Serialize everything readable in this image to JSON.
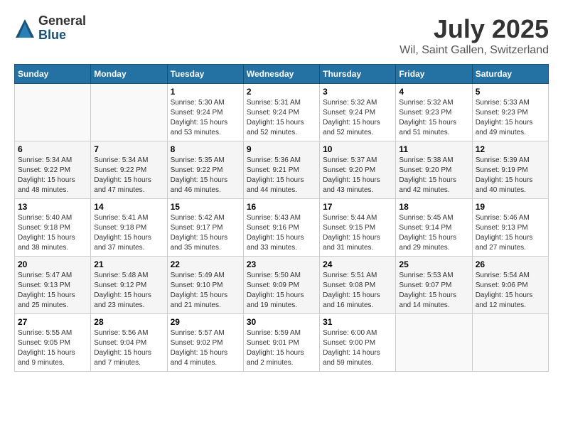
{
  "header": {
    "logo_general": "General",
    "logo_blue": "Blue",
    "month_title": "July 2025",
    "location": "Wil, Saint Gallen, Switzerland"
  },
  "weekdays": [
    "Sunday",
    "Monday",
    "Tuesday",
    "Wednesday",
    "Thursday",
    "Friday",
    "Saturday"
  ],
  "weeks": [
    [
      {
        "day": "",
        "info": ""
      },
      {
        "day": "",
        "info": ""
      },
      {
        "day": "1",
        "info": "Sunrise: 5:30 AM\nSunset: 9:24 PM\nDaylight: 15 hours\nand 53 minutes."
      },
      {
        "day": "2",
        "info": "Sunrise: 5:31 AM\nSunset: 9:24 PM\nDaylight: 15 hours\nand 52 minutes."
      },
      {
        "day": "3",
        "info": "Sunrise: 5:32 AM\nSunset: 9:24 PM\nDaylight: 15 hours\nand 52 minutes."
      },
      {
        "day": "4",
        "info": "Sunrise: 5:32 AM\nSunset: 9:23 PM\nDaylight: 15 hours\nand 51 minutes."
      },
      {
        "day": "5",
        "info": "Sunrise: 5:33 AM\nSunset: 9:23 PM\nDaylight: 15 hours\nand 49 minutes."
      }
    ],
    [
      {
        "day": "6",
        "info": "Sunrise: 5:34 AM\nSunset: 9:22 PM\nDaylight: 15 hours\nand 48 minutes."
      },
      {
        "day": "7",
        "info": "Sunrise: 5:34 AM\nSunset: 9:22 PM\nDaylight: 15 hours\nand 47 minutes."
      },
      {
        "day": "8",
        "info": "Sunrise: 5:35 AM\nSunset: 9:22 PM\nDaylight: 15 hours\nand 46 minutes."
      },
      {
        "day": "9",
        "info": "Sunrise: 5:36 AM\nSunset: 9:21 PM\nDaylight: 15 hours\nand 44 minutes."
      },
      {
        "day": "10",
        "info": "Sunrise: 5:37 AM\nSunset: 9:20 PM\nDaylight: 15 hours\nand 43 minutes."
      },
      {
        "day": "11",
        "info": "Sunrise: 5:38 AM\nSunset: 9:20 PM\nDaylight: 15 hours\nand 42 minutes."
      },
      {
        "day": "12",
        "info": "Sunrise: 5:39 AM\nSunset: 9:19 PM\nDaylight: 15 hours\nand 40 minutes."
      }
    ],
    [
      {
        "day": "13",
        "info": "Sunrise: 5:40 AM\nSunset: 9:18 PM\nDaylight: 15 hours\nand 38 minutes."
      },
      {
        "day": "14",
        "info": "Sunrise: 5:41 AM\nSunset: 9:18 PM\nDaylight: 15 hours\nand 37 minutes."
      },
      {
        "day": "15",
        "info": "Sunrise: 5:42 AM\nSunset: 9:17 PM\nDaylight: 15 hours\nand 35 minutes."
      },
      {
        "day": "16",
        "info": "Sunrise: 5:43 AM\nSunset: 9:16 PM\nDaylight: 15 hours\nand 33 minutes."
      },
      {
        "day": "17",
        "info": "Sunrise: 5:44 AM\nSunset: 9:15 PM\nDaylight: 15 hours\nand 31 minutes."
      },
      {
        "day": "18",
        "info": "Sunrise: 5:45 AM\nSunset: 9:14 PM\nDaylight: 15 hours\nand 29 minutes."
      },
      {
        "day": "19",
        "info": "Sunrise: 5:46 AM\nSunset: 9:13 PM\nDaylight: 15 hours\nand 27 minutes."
      }
    ],
    [
      {
        "day": "20",
        "info": "Sunrise: 5:47 AM\nSunset: 9:13 PM\nDaylight: 15 hours\nand 25 minutes."
      },
      {
        "day": "21",
        "info": "Sunrise: 5:48 AM\nSunset: 9:12 PM\nDaylight: 15 hours\nand 23 minutes."
      },
      {
        "day": "22",
        "info": "Sunrise: 5:49 AM\nSunset: 9:10 PM\nDaylight: 15 hours\nand 21 minutes."
      },
      {
        "day": "23",
        "info": "Sunrise: 5:50 AM\nSunset: 9:09 PM\nDaylight: 15 hours\nand 19 minutes."
      },
      {
        "day": "24",
        "info": "Sunrise: 5:51 AM\nSunset: 9:08 PM\nDaylight: 15 hours\nand 16 minutes."
      },
      {
        "day": "25",
        "info": "Sunrise: 5:53 AM\nSunset: 9:07 PM\nDaylight: 15 hours\nand 14 minutes."
      },
      {
        "day": "26",
        "info": "Sunrise: 5:54 AM\nSunset: 9:06 PM\nDaylight: 15 hours\nand 12 minutes."
      }
    ],
    [
      {
        "day": "27",
        "info": "Sunrise: 5:55 AM\nSunset: 9:05 PM\nDaylight: 15 hours\nand 9 minutes."
      },
      {
        "day": "28",
        "info": "Sunrise: 5:56 AM\nSunset: 9:04 PM\nDaylight: 15 hours\nand 7 minutes."
      },
      {
        "day": "29",
        "info": "Sunrise: 5:57 AM\nSunset: 9:02 PM\nDaylight: 15 hours\nand 4 minutes."
      },
      {
        "day": "30",
        "info": "Sunrise: 5:59 AM\nSunset: 9:01 PM\nDaylight: 15 hours\nand 2 minutes."
      },
      {
        "day": "31",
        "info": "Sunrise: 6:00 AM\nSunset: 9:00 PM\nDaylight: 14 hours\nand 59 minutes."
      },
      {
        "day": "",
        "info": ""
      },
      {
        "day": "",
        "info": ""
      }
    ]
  ]
}
